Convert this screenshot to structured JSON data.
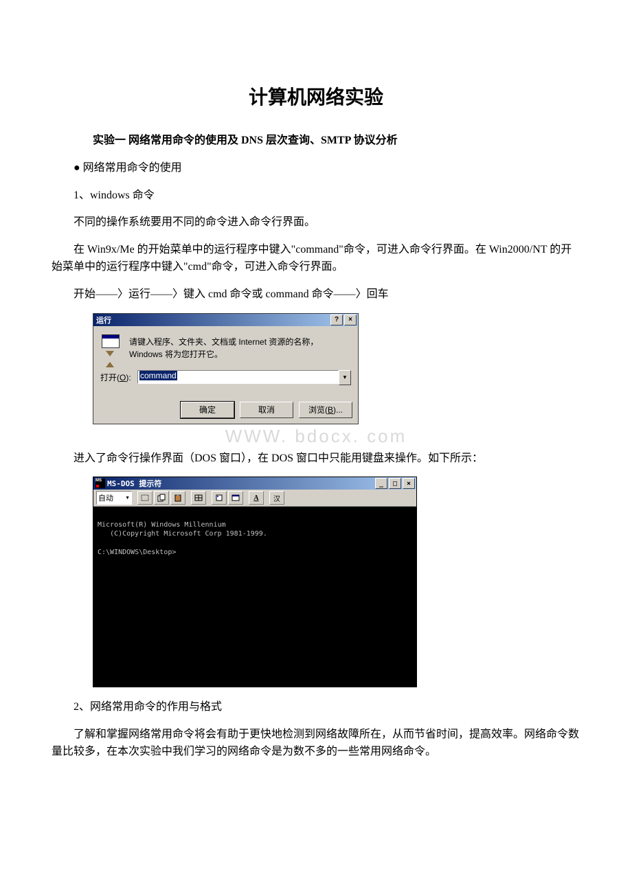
{
  "title": "计算机网络实验",
  "subtitle": "实验一 网络常用命令的使用及 DNS 层次查询、SMTP 协议分析",
  "sec1_bullet": "● 网络常用命令的使用",
  "sec1_1": "1、windows 命令",
  "p1": "不同的操作系统要用不同的命令进入命令行界面。",
  "p2": "在 Win9x/Me 的开始菜单中的运行程序中键入\"command\"命令，可进入命令行界面。在 Win2000/NT 的开始菜单中的运行程序中键入\"cmd\"命令，可进入命令行界面。",
  "p3": "开始——〉运行——〉键入 cmd 命令或 command 命令——〉回车",
  "run": {
    "title": "运行",
    "help": "?",
    "close": "×",
    "desc": "请键入程序、文件夹、文档或 Internet 资源的名称，Windows 将为您打开它。",
    "open_label_pre": "打开(",
    "open_label_u": "O",
    "open_label_post": "):",
    "input": "command",
    "ok": "确定",
    "cancel": "取消",
    "browse_pre": "浏览(",
    "browse_u": "B",
    "browse_post": ")..."
  },
  "watermark": "WWW. bdocx. com",
  "p4": "进入了命令行操作界面（DOS 窗口），在 DOS 窗口中只能用键盘来操作。如下所示：",
  "dos": {
    "title": "MS-DOS 提示符",
    "min": "_",
    "max": "□",
    "close": "×",
    "auto": "自动",
    "btn_a": "A",
    "btn_han": "汉",
    "line1": "Microsoft(R) Windows Millennium",
    "line2": "   (C)Copyright Microsoft Corp 1981-1999.",
    "prompt": "C:\\WINDOWS\\Desktop>"
  },
  "sec2": "2、网络常用命令的作用与格式",
  "p5": "了解和掌握网络常用命令将会有助于更快地检测到网络故障所在，从而节省时间，提高效率。网络命令数量比较多，在本次实验中我们学习的网络命令是为数不多的一些常用网络命令。"
}
